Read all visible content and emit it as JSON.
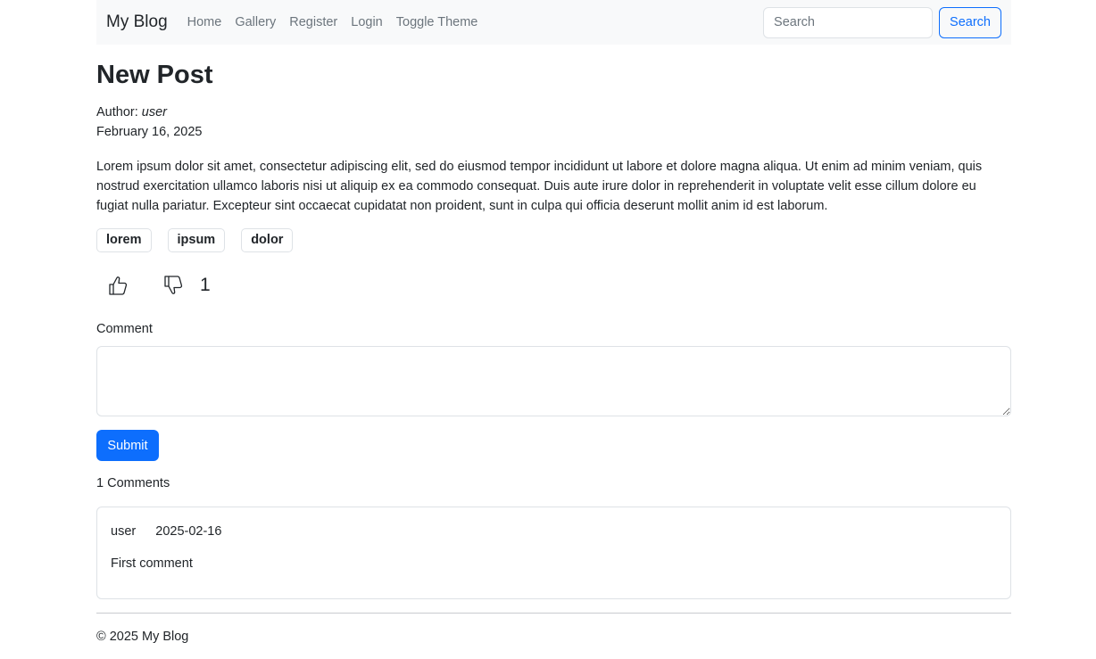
{
  "navbar": {
    "brand": "My Blog",
    "links": [
      "Home",
      "Gallery",
      "Register",
      "Login",
      "Toggle Theme"
    ],
    "search_placeholder": "Search",
    "search_button": "Search"
  },
  "post": {
    "title": "New Post",
    "author_label": "Author: ",
    "author": "user",
    "date": "February 16, 2025",
    "body": "Lorem ipsum dolor sit amet, consectetur adipiscing elit, sed do eiusmod tempor incididunt ut labore et dolore magna aliqua. Ut enim ad minim veniam, quis nostrud exercitation ullamco laboris nisi ut aliquip ex ea commodo consequat. Duis aute irure dolor in reprehenderit in voluptate velit esse cillum dolore eu fugiat nulla pariatur. Excepteur sint occaecat cupidatat non proident, sunt in culpa qui officia deserunt mollit anim id est laborum.",
    "tags": [
      "lorem",
      "ipsum",
      "dolor"
    ],
    "vote_count": "1",
    "like_icon": "thumbs-up-icon",
    "dislike_icon": "thumbs-down-icon"
  },
  "comment_form": {
    "label": "Comment",
    "value": "",
    "submit_label": "Submit"
  },
  "comments": {
    "count_label": "1 Comments",
    "items": [
      {
        "user": "user",
        "date": "2025-02-16",
        "text": "First comment"
      }
    ]
  },
  "footer": {
    "text": "© 2025 My Blog"
  },
  "colors": {
    "primary": "#0d6efd",
    "navbar_bg": "#f8f9fa",
    "muted_text": "#6c757d",
    "border": "#dee2e6"
  }
}
